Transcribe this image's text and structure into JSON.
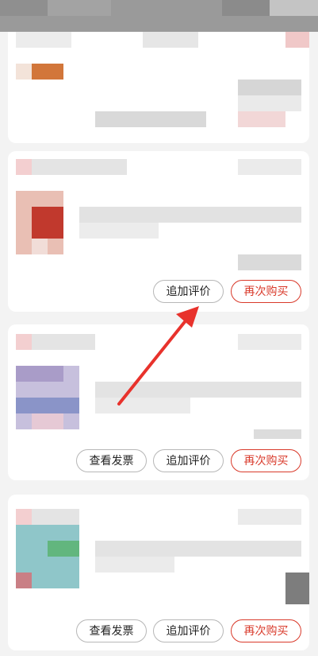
{
  "colors": {
    "accent_red": "#d93a2b",
    "button_border_gray": "#b7b7b7",
    "page_background": "#f3f3f3",
    "arrow": "#e8322c"
  },
  "orders": [
    {
      "buttons": []
    },
    {
      "buttons": [
        {
          "label": "追加评价",
          "style": "gray"
        },
        {
          "label": "再次购买",
          "style": "red"
        }
      ]
    },
    {
      "buttons": [
        {
          "label": "查看发票",
          "style": "gray"
        },
        {
          "label": "追加评价",
          "style": "gray"
        },
        {
          "label": "再次购买",
          "style": "red"
        }
      ]
    },
    {
      "buttons": [
        {
          "label": "查看发票",
          "style": "gray"
        },
        {
          "label": "追加评价",
          "style": "gray"
        },
        {
          "label": "再次购买",
          "style": "red"
        }
      ]
    }
  ],
  "annotation": {
    "icon": "red-arrow-icon"
  }
}
